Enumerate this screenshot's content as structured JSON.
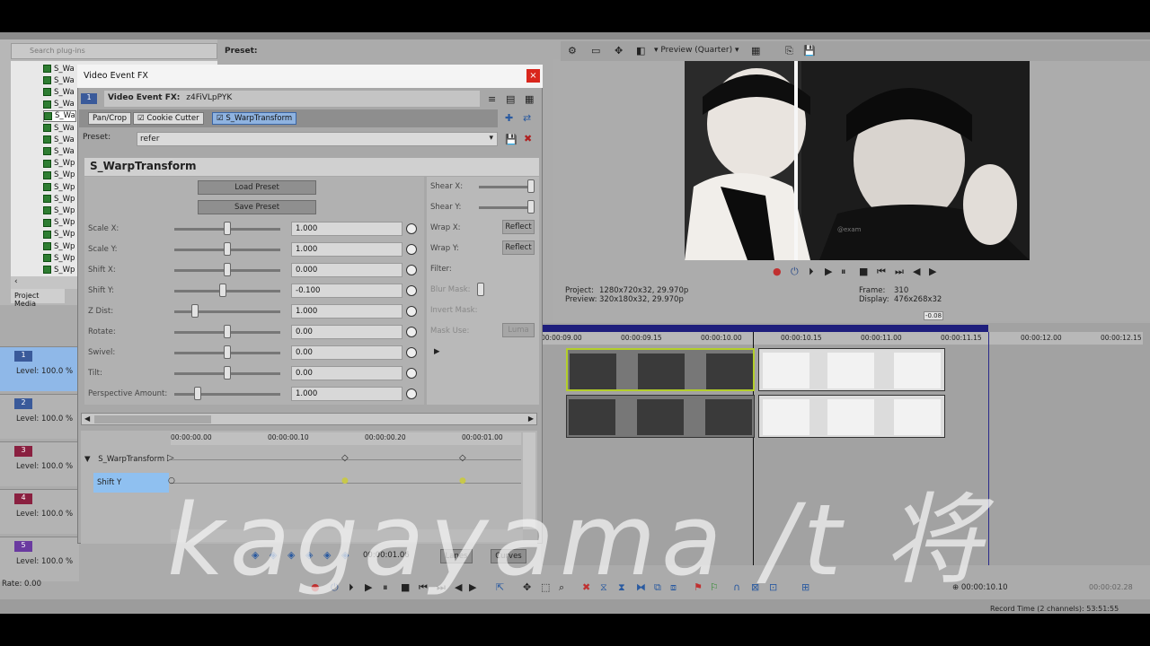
{
  "plugin_list": {
    "search_placeholder": "Search plug-ins",
    "items": [
      "S_Wa",
      "S_Wa",
      "S_Wa",
      "S_Wa",
      "S_Wa",
      "S_Wa",
      "S_Wa",
      "S_Wa",
      "S_Wp",
      "S_Wp",
      "S_Wp",
      "S_Wp",
      "S_Wp",
      "S_Wp",
      "S_Wp",
      "S_Wp",
      "S_Wp",
      "S_Wp"
    ],
    "selected_item": "S_Wa",
    "preset_header": "Preset:",
    "tab": "Project Media"
  },
  "dialog": {
    "title": "Video Event FX",
    "close": "×",
    "fx_label": "Video Event FX:",
    "fx_name": "z4FiVLpPYK",
    "track_num": "1",
    "chain": [
      "Pan/Crop",
      "Cookie Cutter",
      "S_WarpTransform"
    ],
    "preset_label": "Preset:",
    "preset_value": "refer",
    "plugin_title": "S_WarpTransform",
    "load_preset": "Load Preset",
    "save_preset": "Save Preset",
    "params": [
      {
        "label": "Scale X:",
        "value": "1.000",
        "pos": 0.5
      },
      {
        "label": "Scale Y:",
        "value": "1.000",
        "pos": 0.5
      },
      {
        "label": "Shift X:",
        "value": "0.000",
        "pos": 0.5
      },
      {
        "label": "Shift Y:",
        "value": "-0.100",
        "pos": 0.45
      },
      {
        "label": "Z Dist:",
        "value": "1.000",
        "pos": 0.17
      },
      {
        "label": "Rotate:",
        "value": "0.00",
        "pos": 0.5
      },
      {
        "label": "Swivel:",
        "value": "0.00",
        "pos": 0.5
      },
      {
        "label": "Tilt:",
        "value": "0.00",
        "pos": 0.5
      },
      {
        "label": "Perspective Amount:",
        "value": "1.000",
        "pos": 0.2
      }
    ],
    "right": {
      "shear_x": "Shear X:",
      "shear_y": "Shear Y:",
      "wrap_x": "Wrap X:",
      "wrap_y": "Wrap Y:",
      "reflect": "Reflect",
      "filter": "Filter:",
      "blur_mask": "Blur Mask:",
      "invert_mask": "Invert Mask:",
      "mask_use": "Mask Use:",
      "luma": "Luma"
    },
    "keyframes": {
      "ticks": [
        "00:00:00.00",
        "00:00:00.10",
        "00:00:00.20",
        "00:00:01.00"
      ],
      "row1": "S_WarpTransform",
      "row2": "Shift Y",
      "time": "00:00:01.06",
      "lanes": "Lanes",
      "curves": "Curves"
    }
  },
  "preview": {
    "mode": "Preview (Quarter)",
    "project_label": "Project:",
    "project_value": "1280x720x32, 29.970p",
    "preview_label": "Preview:",
    "preview_value": "320x180x32, 29.970p",
    "frame_label": "Frame:",
    "frame_value": "310",
    "display_label": "Display:",
    "display_value": "476x268x32",
    "overlay_text": "@exam"
  },
  "tracks": [
    {
      "num": "1",
      "level": "Level: 100.0 %",
      "color": "#3a5a9a"
    },
    {
      "num": "2",
      "level": "Level: 100.0 %",
      "color": "#3a5a9a"
    },
    {
      "num": "3",
      "level": "Level: 100.0 %",
      "color": "#8a2040"
    },
    {
      "num": "4",
      "level": "Level: 100.0 %",
      "color": "#8a2040"
    },
    {
      "num": "5",
      "level": "Level: 100.0 %",
      "color": "#6a3aa0"
    }
  ],
  "timeline": {
    "ticks": [
      "00:00:09.00",
      "00:00:09.15",
      "00:00:10.00",
      "00:00:10.15",
      "00:00:11.00",
      "00:00:11.15",
      "00:00:12.00",
      "00:00:12.15"
    ],
    "region": "-0.08",
    "cursor_time": "00:00:10.10",
    "end_time": "00:00:02.28",
    "rate": "Rate: 0.00",
    "record_time": "Record Time (2 channels): 53:51:55"
  },
  "watermark": "kagayama /t 将"
}
